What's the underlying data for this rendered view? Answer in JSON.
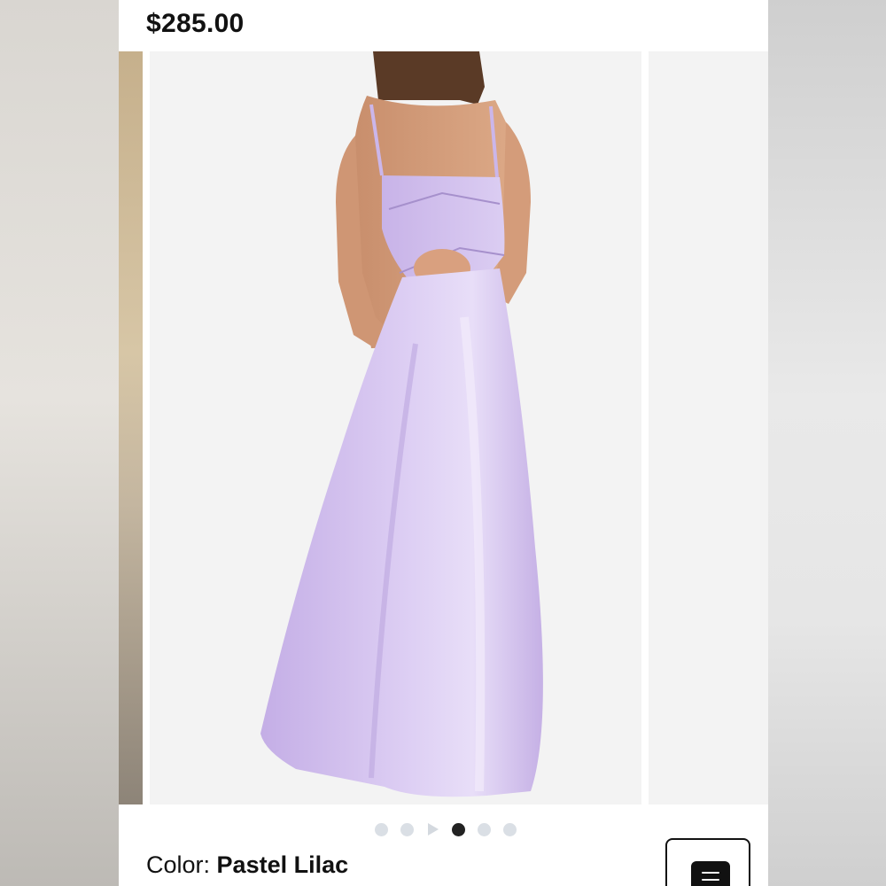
{
  "product": {
    "price": "$285.00",
    "color_label": "Color:",
    "color_value": "Pastel Lilac"
  },
  "gallery": {
    "slide_count": 6,
    "active_index": 3,
    "video_indicator_index": 2,
    "dress_color": "#cdb8ea"
  },
  "icons": {
    "menu": "menu-icon",
    "play": "play-icon"
  }
}
